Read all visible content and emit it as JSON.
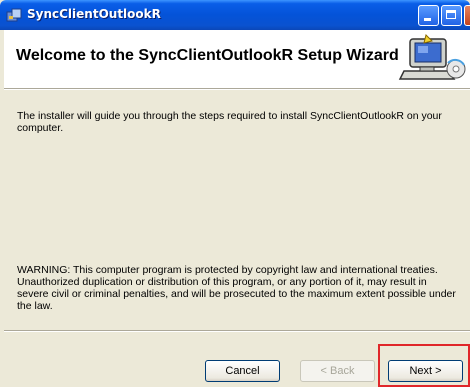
{
  "window": {
    "title": "SyncClientOutlookR"
  },
  "header": {
    "title": "Welcome to the SyncClientOutlookR Setup Wizard"
  },
  "content": {
    "intro": "The installer will guide you through the steps required to install SyncClientOutlookR on your computer.",
    "warning": "WARNING: This computer program is protected by copyright law and international treaties. Unauthorized duplication or distribution of this program, or any portion of it, may result in severe civil or criminal penalties, and will be prosecuted to the maximum extent possible under the law."
  },
  "buttons": {
    "cancel": "Cancel",
    "back": "< Back",
    "next": "Next >"
  },
  "icons": {
    "window_icon": "installer-icon",
    "header_art": "computer-setup-icon"
  },
  "colors": {
    "titlebar": "#0453d8",
    "highlight": "#e0272a",
    "dialog_bg": "#ece9d8"
  }
}
